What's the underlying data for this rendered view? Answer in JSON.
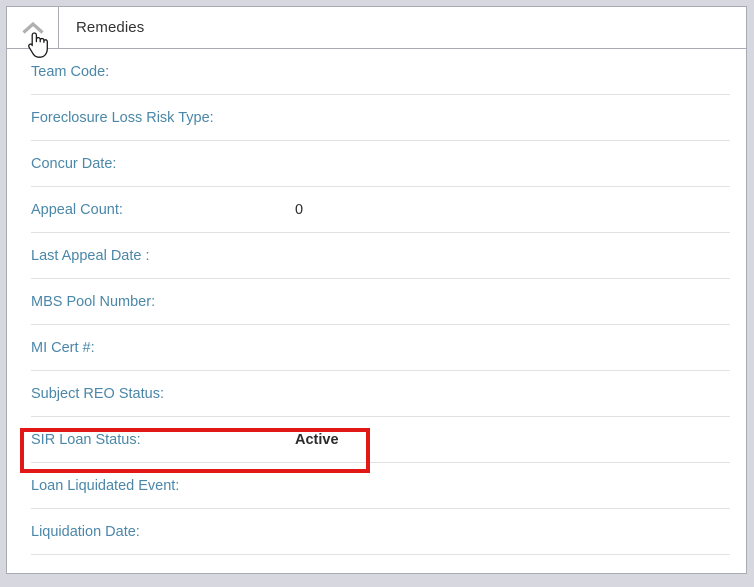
{
  "panel": {
    "title": "Remedies",
    "collapse_icon": "chevron-up-icon",
    "cursor_icon": "hand-pointer-cursor",
    "accent_label_color": "#4a87a8",
    "value_color": "#2b2b2b",
    "highlight_color": "#e21717",
    "divider_color": "#e2e2e4",
    "border_color": "#a8aab4",
    "page_background": "#d7d8df"
  },
  "rows": [
    {
      "label": "Team Code:",
      "value": ""
    },
    {
      "label": "Foreclosure Loss Risk Type:",
      "value": ""
    },
    {
      "label": "Concur Date:",
      "value": ""
    },
    {
      "label": "Appeal Count:",
      "value": "0"
    },
    {
      "label": "Last Appeal Date :",
      "value": ""
    },
    {
      "label": "MBS Pool Number:",
      "value": ""
    },
    {
      "label": "MI Cert #:",
      "value": ""
    },
    {
      "label": "Subject REO Status:",
      "value": ""
    },
    {
      "label": "SIR Loan Status:",
      "value": "Active"
    },
    {
      "label": "Loan Liquidated Event:",
      "value": ""
    },
    {
      "label": "Liquidation Date:",
      "value": ""
    }
  ]
}
